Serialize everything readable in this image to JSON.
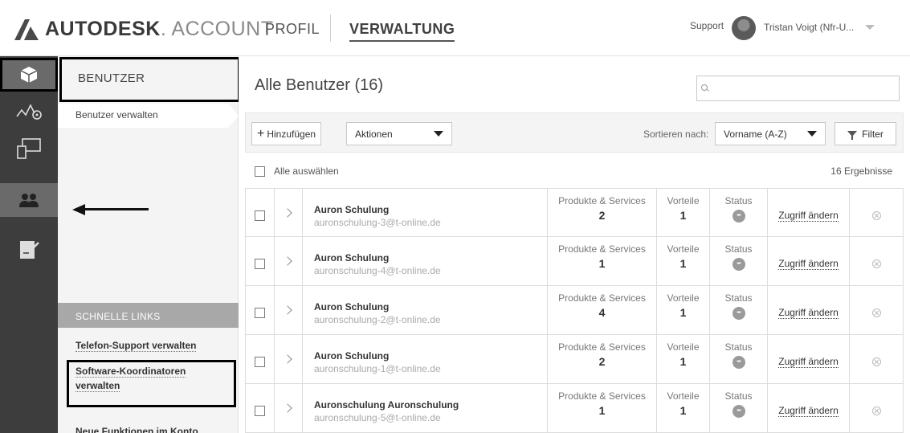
{
  "header": {
    "logo_brand": "AUTODESK",
    "logo_product": ". ACCOUNT",
    "tabs": [
      {
        "label": "PROFIL"
      },
      {
        "label": "VERWALTUNG"
      }
    ],
    "support_label": "Support",
    "user_label": "Tristan Voigt (Nfr-U..."
  },
  "rail": {
    "icons": [
      "cube-icon",
      "analytics-icon",
      "devices-icon",
      "users-icon",
      "document-icon"
    ]
  },
  "sidebar": {
    "section_title": "BENUTZER",
    "active_item": "Benutzer verwalten",
    "quick_links_title": "SCHNELLE LINKS",
    "links": [
      {
        "label": "Telefon-Support verwalten"
      },
      {
        "label": "Software-Koordinatoren verwalten"
      },
      {
        "label": "Neue Funktionen im Konto"
      }
    ]
  },
  "main": {
    "title": "Alle Benutzer (16)",
    "search_placeholder": "",
    "toolbar": {
      "add_label": "Hinzufügen",
      "actions_label": "Aktionen",
      "sort_label": "Sortieren nach:",
      "sort_value": "Vorname (A-Z)",
      "filter_label": "Filter"
    },
    "select_all_label": "Alle auswählen",
    "results_label": "16 Ergebnisse",
    "columns": {
      "products": "Produkte & Services",
      "benefits": "Vorteile",
      "status": "Status",
      "access": "Zugriff ändern"
    },
    "users": [
      {
        "name": "Auron Schulung",
        "email": "auronschulung-3@t-online.de",
        "products": "2",
        "benefits": "1"
      },
      {
        "name": "Auron Schulung",
        "email": "auronschulung-4@t-online.de",
        "products": "1",
        "benefits": "1"
      },
      {
        "name": "Auron Schulung",
        "email": "auronschulung-2@t-online.de",
        "products": "4",
        "benefits": "1"
      },
      {
        "name": "Auron Schulung",
        "email": "auronschulung-1@t-online.de",
        "products": "2",
        "benefits": "1"
      },
      {
        "name": "Auronschulung Auronschulung",
        "email": "auronschulung-5@t-online.de",
        "products": "1",
        "benefits": "1"
      }
    ]
  }
}
